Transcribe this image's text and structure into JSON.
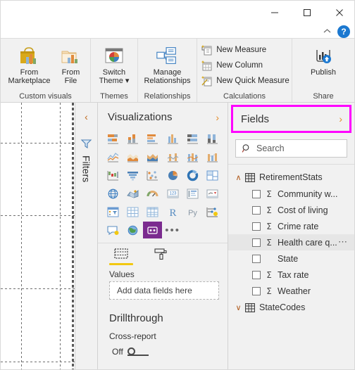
{
  "window": {
    "controls": [
      {
        "name": "minimize",
        "glyph": "—"
      },
      {
        "name": "maximize",
        "glyph": "□"
      },
      {
        "name": "close",
        "glyph": "✕"
      }
    ],
    "ribbon_collapse_glyph": "⌃",
    "help_label": "?"
  },
  "ribbon": {
    "groups": [
      {
        "label": "Custom visuals",
        "buttons": [
          {
            "label": "From\nMarketplace",
            "icon": "marketplace-bag-icon"
          },
          {
            "label": "From\nFile",
            "icon": "folder-chart-icon"
          }
        ]
      },
      {
        "label": "Themes",
        "buttons": [
          {
            "label": "Switch\nTheme ▾",
            "icon": "switch-theme-icon"
          }
        ]
      },
      {
        "label": "Relationships",
        "buttons": [
          {
            "label": "Manage\nRelationships",
            "icon": "manage-relationships-icon"
          }
        ]
      },
      {
        "label": "Calculations",
        "small_buttons": [
          {
            "label": "New Measure",
            "icon": "new-measure-icon"
          },
          {
            "label": "New Column",
            "icon": "new-column-icon"
          },
          {
            "label": "New Quick Measure",
            "icon": "new-quick-measure-icon"
          }
        ]
      },
      {
        "label": "Share",
        "buttons": [
          {
            "label": "Publish",
            "icon": "publish-icon"
          }
        ]
      }
    ]
  },
  "filters_rail": {
    "collapse_glyph": "‹",
    "icon": "filter-funnel-icon",
    "title": "Filters"
  },
  "visualizations": {
    "title": "Visualizations",
    "expand_glyph": "›",
    "icons": [
      "stacked-bar-chart-icon",
      "stacked-column-chart-icon",
      "clustered-bar-chart-icon",
      "clustered-column-chart-icon",
      "hundred-percent-stacked-bar-icon",
      "hundred-percent-stacked-column-icon",
      "line-chart-icon",
      "area-chart-icon",
      "stacked-area-chart-icon",
      "line-stacked-column-chart-icon",
      "line-clustered-column-chart-icon",
      "ribbon-chart-icon",
      "waterfall-chart-icon",
      "funnel-chart-icon",
      "scatter-chart-icon",
      "pie-chart-icon",
      "donut-chart-icon",
      "treemap-icon",
      "map-icon",
      "filled-map-icon",
      "gauge-icon",
      "card-icon",
      "multi-row-card-icon",
      "kpi-icon",
      "slicer-icon",
      "table-icon",
      "matrix-icon",
      "r-script-visual-icon",
      "python-visual-icon",
      "key-influencers-icon",
      "qna-visual-icon",
      "arcgis-map-icon",
      "paginated-report-icon"
    ],
    "more_glyph": "•••",
    "selected_icon_index": 32,
    "tabs": [
      {
        "name": "fields-tab",
        "icon": "fields-bucket-icon",
        "active": true
      },
      {
        "name": "format-tab",
        "icon": "paint-roller-icon",
        "active": false
      }
    ],
    "bucket_label": "Values",
    "dropzone_placeholder": "Add data fields here",
    "drillthrough": {
      "title": "Drillthrough",
      "cross_report_label": "Cross-report",
      "toggle_state": "Off"
    }
  },
  "fields": {
    "title": "Fields",
    "expand_glyph": "›",
    "highlight_color": "#ff00ff",
    "search": {
      "placeholder": "Search",
      "icon": "search-icon",
      "value": ""
    },
    "tables": [
      {
        "name": "RetirementStats",
        "expanded": true,
        "chevron": "∧",
        "icon": "table-icon",
        "fields": [
          {
            "label": "Community w...",
            "measure": true,
            "checked": false,
            "hover": false,
            "menu": false
          },
          {
            "label": "Cost of living",
            "measure": true,
            "checked": false,
            "hover": false,
            "menu": false
          },
          {
            "label": "Crime rate",
            "measure": true,
            "checked": false,
            "hover": false,
            "menu": false
          },
          {
            "label": "Health care q...",
            "measure": true,
            "checked": false,
            "hover": true,
            "menu": true
          },
          {
            "label": "State",
            "measure": false,
            "checked": false,
            "hover": false,
            "menu": false
          },
          {
            "label": "Tax rate",
            "measure": true,
            "checked": false,
            "hover": false,
            "menu": false
          },
          {
            "label": "Weather",
            "measure": true,
            "checked": false,
            "hover": false,
            "menu": false
          }
        ]
      },
      {
        "name": "StateCodes",
        "expanded": false,
        "chevron": "∨",
        "icon": "table-icon",
        "fields": []
      }
    ]
  }
}
